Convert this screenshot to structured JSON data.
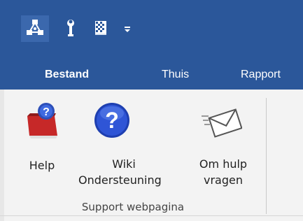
{
  "quick_access": {
    "items": [
      "network-icon",
      "wrench-icon",
      "grid-icon",
      "dropdown-arrow-icon"
    ]
  },
  "tabs": [
    {
      "label": "Bestand",
      "selected": true
    },
    {
      "label": "Thuis",
      "selected": false
    },
    {
      "label": "Rapport",
      "selected": false
    }
  ],
  "ribbon": {
    "buttons": [
      {
        "label": "Help",
        "icon": "help-book-icon"
      },
      {
        "label_line1": "Wiki",
        "label_line2": "Ondersteuning",
        "icon": "question-circle-icon"
      },
      {
        "label_line1": "Om hulp",
        "label_line2": "vragen",
        "icon": "envelope-icon"
      }
    ],
    "group_label": "Support webpagina"
  },
  "colors": {
    "title_bar": "#2b579a",
    "ribbon_bg": "#f3f3f3"
  }
}
